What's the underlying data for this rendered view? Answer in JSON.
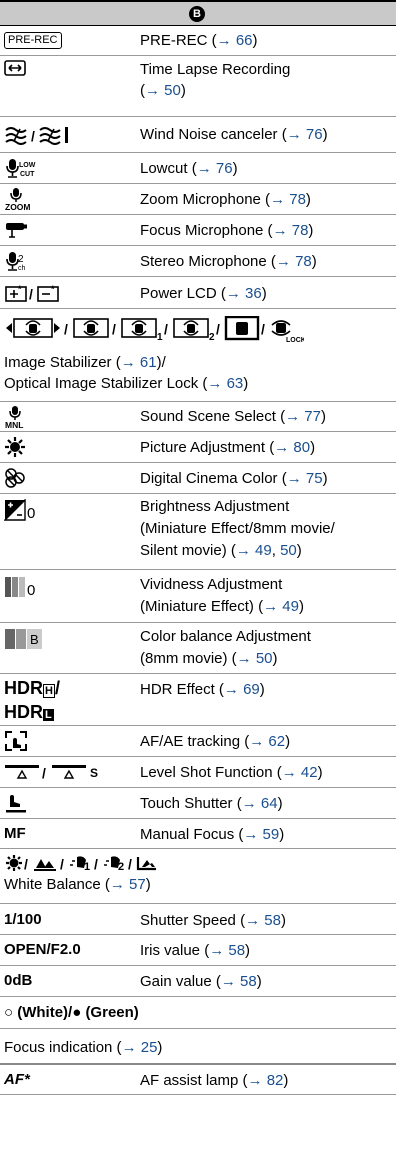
{
  "header": {
    "badge": "B"
  },
  "rows": [
    {
      "icon_text": "PRE-REC",
      "text": "PRE-REC (",
      "ref": "→ 66",
      "close": ")"
    },
    {
      "text": "Time Lapse Recording",
      "text2": "(",
      "ref": "→ 50",
      "close": ")"
    },
    {
      "text": "Wind Noise canceler (",
      "ref": "→ 76",
      "close": ")"
    },
    {
      "text": "Lowcut (",
      "ref": "→ 76",
      "close": ")"
    },
    {
      "text": "Zoom Microphone (",
      "ref": "→ 78",
      "close": ")"
    },
    {
      "text": "Focus Microphone (",
      "ref": "→ 78",
      "close": ")"
    },
    {
      "text": "Stereo Microphone (",
      "ref": "→ 78",
      "close": ")"
    },
    {
      "text": "Power LCD (",
      "ref": "→ 36",
      "close": ")"
    },
    {
      "text": "Image Stabilizer (",
      "ref": "→ 61",
      "close": ")/",
      "text2": "Optical Image Stabilizer Lock (",
      "ref2": "→ 63",
      "close2": ")"
    },
    {
      "text": "Sound Scene Select (",
      "ref": "→ 77",
      "close": ")"
    },
    {
      "text": "Picture Adjustment (",
      "ref": "→ 80",
      "close": ")"
    },
    {
      "text": "Digital Cinema Color (",
      "ref": "→ 75",
      "close": ")"
    },
    {
      "icon_sub": "0",
      "text": "Brightness Adjustment",
      "text2": "(Miniature Effect/8mm movie/",
      "text3": "Silent movie) (",
      "ref": "→ 49",
      "mid": ", ",
      "ref2": "50",
      "close": ")"
    },
    {
      "icon_sub": "0",
      "text": "Vividness Adjustment",
      "text2": "(Miniature Effect) (",
      "ref": "→ 49",
      "close": ")"
    },
    {
      "text": "Color balance Adjustment",
      "text2": "(8mm movie) (",
      "ref": "→ 50",
      "close": ")"
    },
    {
      "icon_text": "HDR",
      "icon_text2": "HDR",
      "text": "HDR Effect (",
      "ref": "→ 69",
      "close": ")"
    },
    {
      "text": "AF/AE tracking (",
      "ref": "→ 62",
      "close": ")"
    },
    {
      "icon_text": "S",
      "text": "Level Shot Function (",
      "ref": "→ 42",
      "close": ")"
    },
    {
      "text": "Touch Shutter (",
      "ref": "→ 64",
      "close": ")"
    },
    {
      "icon_text": "MF",
      "text": "Manual Focus (",
      "ref": "→ 59",
      "close": ")"
    },
    {
      "text": "White Balance (",
      "ref": "→ 57",
      "close": ")"
    },
    {
      "icon_text": "1/100",
      "text": "Shutter Speed (",
      "ref": "→ 58",
      "close": ")"
    },
    {
      "icon_text": "OPEN/F2.0",
      "text": "Iris value (",
      "ref": "→ 58",
      "close": ")"
    },
    {
      "icon_text": "0dB",
      "text": "Gain value (",
      "ref": "→ 58",
      "close": ")"
    },
    {
      "icon_text": "○ (White)/● (Green)"
    },
    {
      "text": "Focus indication (",
      "ref": "→ 25",
      "close": ")"
    },
    {
      "icon_text": "AF*",
      "text": "AF assist lamp (",
      "ref": "→ 82",
      "close": ")"
    }
  ]
}
